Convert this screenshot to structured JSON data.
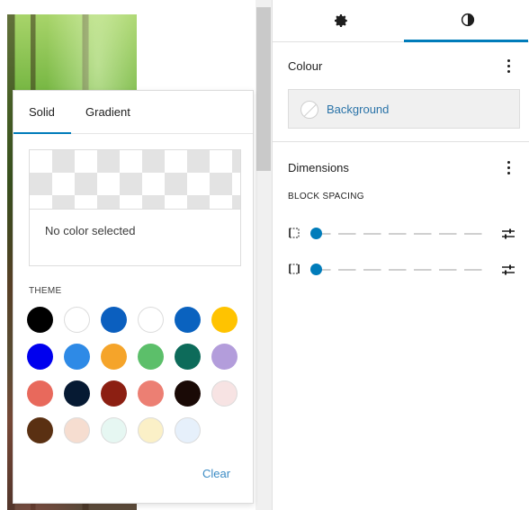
{
  "colors": {
    "accent": "#007cba",
    "link": "#3b8bc4"
  },
  "popover": {
    "tabs": [
      {
        "label": "Solid",
        "active": true
      },
      {
        "label": "Gradient",
        "active": false
      }
    ],
    "preview_text": "No color selected",
    "theme_heading": "THEME",
    "swatches": [
      "#000000",
      "#ffffff",
      "#0b5fbf",
      "#ffffff",
      "#0a62bf",
      "#ffc300",
      "#0000ee",
      "#2e8ae6",
      "#f5a42a",
      "#5cbf6a",
      "#0d6b5a",
      "#b39ddb",
      "#e8695c",
      "#061a33",
      "#8c1f12",
      "#ec7f73",
      "#1a0a06",
      "#f7e3e3",
      "#5a3012",
      "#f6ddd0",
      "#e6f7f2",
      "#fbf0c7",
      "#e6f0fb"
    ],
    "clear_label": "Clear"
  },
  "sidebar": {
    "tabs": [
      {
        "icon": "gear-icon",
        "active": false
      },
      {
        "icon": "contrast-icon",
        "active": true
      }
    ],
    "colour_panel": {
      "title": "Colour",
      "background_label": "Background"
    },
    "dimensions_panel": {
      "title": "Dimensions",
      "block_spacing_label": "BLOCK SPACING",
      "rows": [
        {
          "name": "vertical",
          "value": 0
        },
        {
          "name": "horizontal",
          "value": 0
        }
      ]
    }
  }
}
